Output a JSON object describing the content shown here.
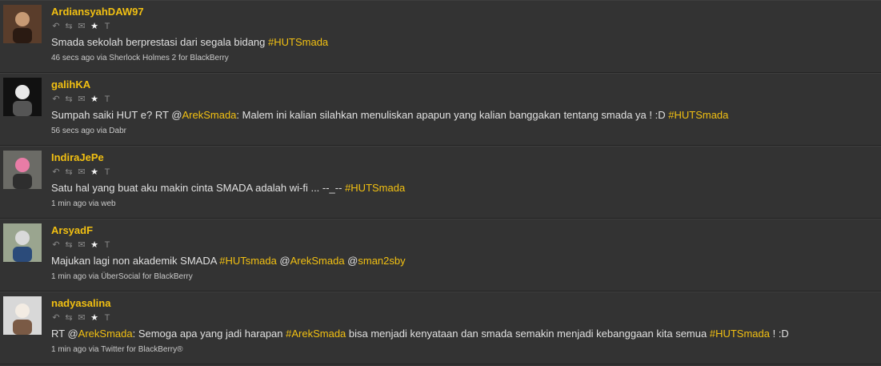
{
  "colors": {
    "accent": "#f2c012",
    "background": "#333333",
    "text": "#e0e0e0"
  },
  "icons": [
    "reply-icon",
    "retweet-icon",
    "direct-message-icon",
    "favorite-star-icon",
    "translate-icon"
  ],
  "tweets": [
    {
      "user": "ArdiansyahDAW97",
      "text_parts": [
        {
          "t": "Smada sekolah berprestasi dari segala bidang "
        },
        {
          "t": "#HUTSmada",
          "link": true
        }
      ],
      "time": "46 secs ago",
      "via": "via Sherlock Holmes 2 for BlackBerry"
    },
    {
      "user": "galihKA",
      "text_parts": [
        {
          "t": "Sumpah saiki HUT e? RT @"
        },
        {
          "t": "ArekSmada",
          "link": true
        },
        {
          "t": ": Malem ini kalian silahkan menuliskan apapun yang kalian banggakan tentang smada ya ! :D "
        },
        {
          "t": "#HUTSmada",
          "link": true
        }
      ],
      "time": "56 secs ago",
      "via": "via Dabr"
    },
    {
      "user": "IndiraJePe",
      "text_parts": [
        {
          "t": "Satu hal yang buat aku makin cinta SMADA adalah wi-fi ... --_-- "
        },
        {
          "t": "#HUTSmada",
          "link": true
        }
      ],
      "time": "1 min ago",
      "via": "via web"
    },
    {
      "user": "ArsyadF",
      "text_parts": [
        {
          "t": "Majukan lagi non akademik SMADA "
        },
        {
          "t": "#HUTsmada",
          "link": true
        },
        {
          "t": " @"
        },
        {
          "t": "ArekSmada",
          "link": true
        },
        {
          "t": " @"
        },
        {
          "t": "sman2sby",
          "link": true
        }
      ],
      "time": "1 min ago",
      "via": "via ÜberSocial for BlackBerry"
    },
    {
      "user": "nadyasalina",
      "text_parts": [
        {
          "t": "RT @"
        },
        {
          "t": "ArekSmada",
          "link": true
        },
        {
          "t": ": Semoga apa yang jadi harapan "
        },
        {
          "t": "#ArekSmada",
          "link": true
        },
        {
          "t": " bisa menjadi kenyataan dan smada semakin menjadi kebanggaan kita semua "
        },
        {
          "t": "#HUTSmada",
          "link": true
        },
        {
          "t": " ! :D"
        }
      ],
      "time": "1 min ago",
      "via": "via Twitter for BlackBerry®"
    }
  ]
}
